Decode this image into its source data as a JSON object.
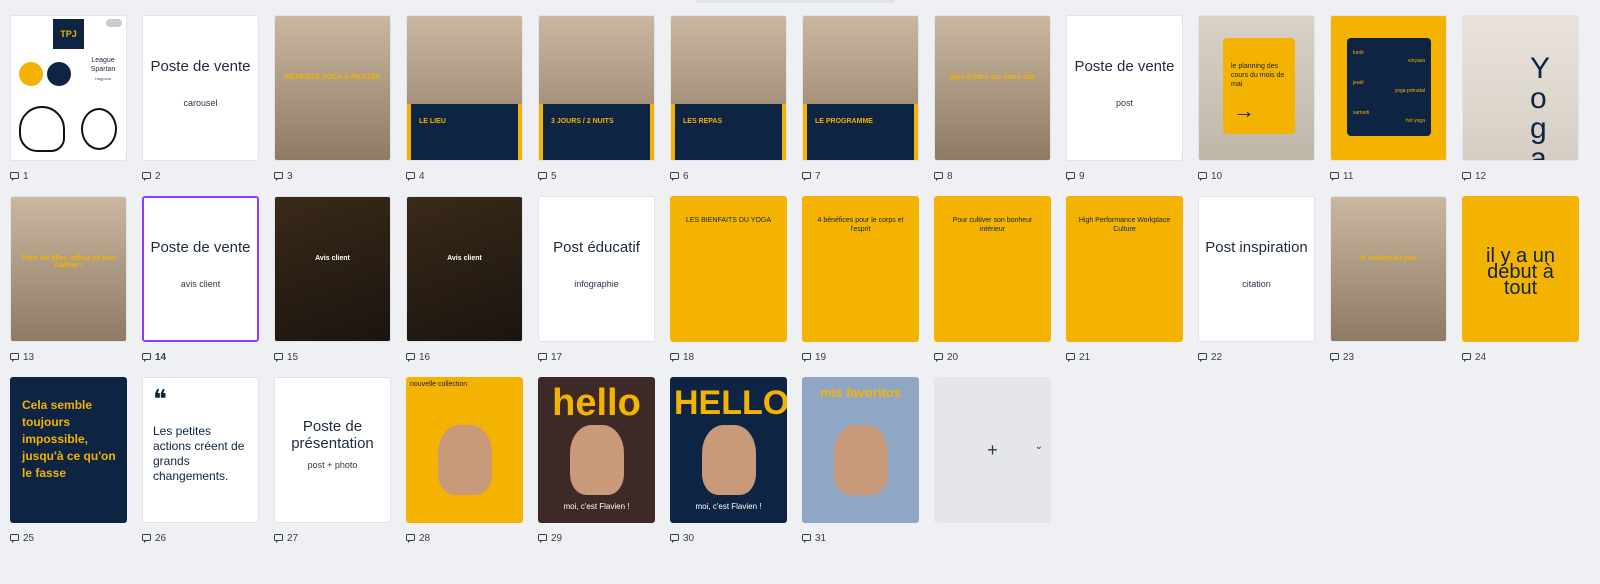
{
  "pages": [
    {
      "n": "1",
      "kind": "brand"
    },
    {
      "n": "2",
      "kind": "white",
      "title": "Poste de vente",
      "sub": "carousel"
    },
    {
      "n": "3",
      "kind": "photo",
      "text": "RETRAITE YOGA & PILATES"
    },
    {
      "n": "4",
      "kind": "photo-navy",
      "text": "LE LIEU"
    },
    {
      "n": "5",
      "kind": "photo-navy",
      "text": "3 JOURS / 2 NUITS"
    },
    {
      "n": "6",
      "kind": "photo-navy",
      "text": "LES REPAS"
    },
    {
      "n": "7",
      "kind": "photo-navy",
      "text": "LE PROGRAMME"
    },
    {
      "n": "8",
      "kind": "photo",
      "text": "plus d'infos sur notre site"
    },
    {
      "n": "9",
      "kind": "white",
      "title": "Poste de vente",
      "sub": "post"
    },
    {
      "n": "10",
      "kind": "planning",
      "text": "le planning des cours du mois de mai"
    },
    {
      "n": "11",
      "kind": "schedule",
      "days": [
        "lundi",
        "jeudi",
        "samedi"
      ],
      "classes": [
        "vinyasa",
        "yoga prénatal",
        "hot yoga"
      ]
    },
    {
      "n": "12",
      "kind": "yoga",
      "text": "Yoga"
    },
    {
      "n": "13",
      "kind": "photo",
      "text": "Pour les filles, offrez un bon cadeau !"
    },
    {
      "n": "14",
      "kind": "white",
      "title": "Poste de vente",
      "sub": "avis client",
      "selected": true
    },
    {
      "n": "15",
      "kind": "photo-dark",
      "text": "Avis client"
    },
    {
      "n": "16",
      "kind": "photo-dark",
      "text": "Avis client"
    },
    {
      "n": "17",
      "kind": "white",
      "title": "Post éducatif",
      "sub": "infographie"
    },
    {
      "n": "18",
      "kind": "yellow",
      "text": "LES BIENFAITS DU YOGA"
    },
    {
      "n": "19",
      "kind": "yellow",
      "text": "4 bénéfices pour le corps et l'esprit"
    },
    {
      "n": "20",
      "kind": "yellow",
      "text": "Pour cultiver son bonheur intérieur"
    },
    {
      "n": "21",
      "kind": "yellow",
      "text": "High Performance Workplace Culture"
    },
    {
      "n": "22",
      "kind": "white",
      "title": "Post inspiration",
      "sub": "citation"
    },
    {
      "n": "23",
      "kind": "photo",
      "text": "le mantra du jour"
    },
    {
      "n": "24",
      "kind": "yellow-big",
      "text": "il y a un début à tout"
    },
    {
      "n": "25",
      "kind": "navy-quote",
      "text": "Cela semble toujours impossible, jusqu'à ce qu'on le fasse"
    },
    {
      "n": "26",
      "kind": "white-quote",
      "text": "Les petites actions créent de grands changements."
    },
    {
      "n": "27",
      "kind": "white",
      "title": "Poste de présentation",
      "sub": "post + photo"
    },
    {
      "n": "28",
      "kind": "portrait-yellow",
      "text": "nouvelle collection"
    },
    {
      "n": "29",
      "kind": "portrait-hello",
      "text": "hello",
      "caption": "moi, c'est Flavien !"
    },
    {
      "n": "30",
      "kind": "portrait-HELLO",
      "text": "HELLO",
      "caption": "moi, c'est Flavien !"
    },
    {
      "n": "31",
      "kind": "favoritos",
      "text": "mis favoritos"
    }
  ],
  "brand": {
    "logo": "TPJ",
    "name": "League Spartan",
    "sub": "Hagpana"
  },
  "add_tile": {
    "plus": "+",
    "chevron": "⌄"
  },
  "colors": {
    "accent": "#f5b301",
    "navy": "#0d2442",
    "selected": "#8b3dff"
  }
}
